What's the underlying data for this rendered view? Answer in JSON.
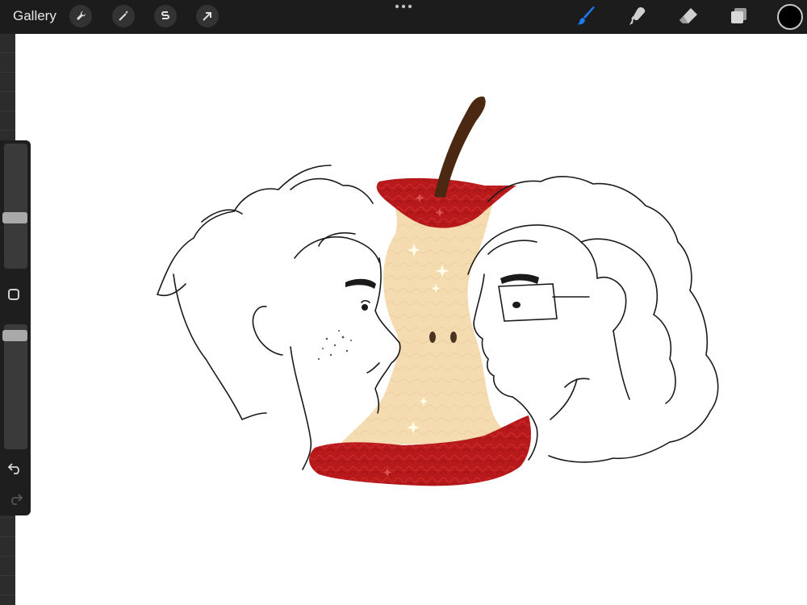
{
  "toolbar": {
    "gallery_label": "Gallery",
    "left_tools": [
      "wrench-icon",
      "magic-wand-icon",
      "selection-s-icon",
      "transform-arrow-icon"
    ],
    "right_tools": [
      "brush-icon",
      "smudge-icon",
      "eraser-icon",
      "layers-icon"
    ],
    "active_tool": "brush-icon",
    "active_tool_color": "#1e7bf0",
    "current_color": "#000000"
  },
  "sidebar": {
    "brush_size_level": 0.4,
    "opacity_level": 0.05,
    "modify_icon": "square-icon",
    "undo_icon": "undo-icon",
    "redo_icon": "redo-icon"
  },
  "canvas": {
    "background": "#ffffff",
    "artwork": "apple-core-two-faces-drawing",
    "colors": {
      "apple_red": "#b51a1a",
      "apple_flesh": "#f3dcb1",
      "stem": "#4a2812",
      "line": "#1a1a1a"
    }
  }
}
